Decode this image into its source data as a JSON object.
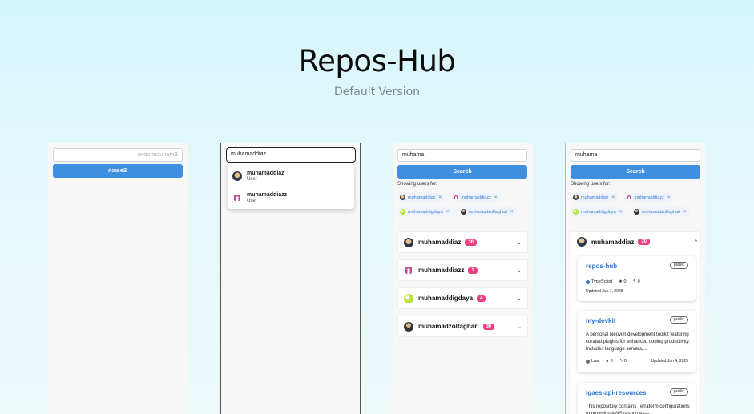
{
  "hero": {
    "title": "Repos-Hub",
    "subtitle": "Default Version"
  },
  "panel1": {
    "placeholder": "Enter username",
    "button": "Search"
  },
  "panel2": {
    "query": "muhamaddiaz",
    "suggestions": [
      {
        "name": "muhamaddiaz",
        "role": "User"
      },
      {
        "name": "muhamaddiazz",
        "role": "User"
      }
    ]
  },
  "panel3": {
    "query": "muhama",
    "button": "Search",
    "showing": "Showing users for:",
    "chips": [
      "muhamaddiaz",
      "muhamaddiazz",
      "muhamaddigdaya",
      "muhamadzolfaghari"
    ],
    "chip_close": "×",
    "users": [
      {
        "name": "muhamaddiaz",
        "count": "30"
      },
      {
        "name": "muhamaddiazz",
        "count": "1"
      },
      {
        "name": "muhamaddigdaya",
        "count": "4"
      },
      {
        "name": "muhamadzolfaghari",
        "count": "30"
      }
    ],
    "chevron": "⌄"
  },
  "panel4": {
    "query": "muhama",
    "button": "Search",
    "showing": "Showing users for:",
    "chips": [
      "muhamaddiaz",
      "muhamaddiazz",
      "muhamaddigdaya",
      "muhamadzolfaghari"
    ],
    "chip_close": "×",
    "expanded_user": {
      "name": "muhamaddiaz",
      "count": "30",
      "chevron": "^"
    },
    "repos": [
      {
        "name": "repos-hub",
        "visibility": "public",
        "language": "TypeScript",
        "language_color": "#3178c6",
        "stars": "0",
        "forks": "0",
        "updated": "Updated Jun 7, 2025"
      },
      {
        "name": "my-devkit",
        "visibility": "public",
        "description": "A personal Neovim development toolkit featuring curated plugins for enhanced coding productivity. Includes language servers,...",
        "language": "Lua",
        "language_color": "#6a6a6a",
        "stars": "0",
        "forks": "0",
        "updated": "Updated Jun 4, 2025"
      },
      {
        "name": "igaes-api-resources",
        "visibility": "public",
        "description": "This repository contains Terraform configurations to provision AWS resources—"
      }
    ]
  },
  "colors": {
    "accent": "#3f8fe0",
    "badge": "#ec3f83",
    "link": "#2a78d2"
  }
}
